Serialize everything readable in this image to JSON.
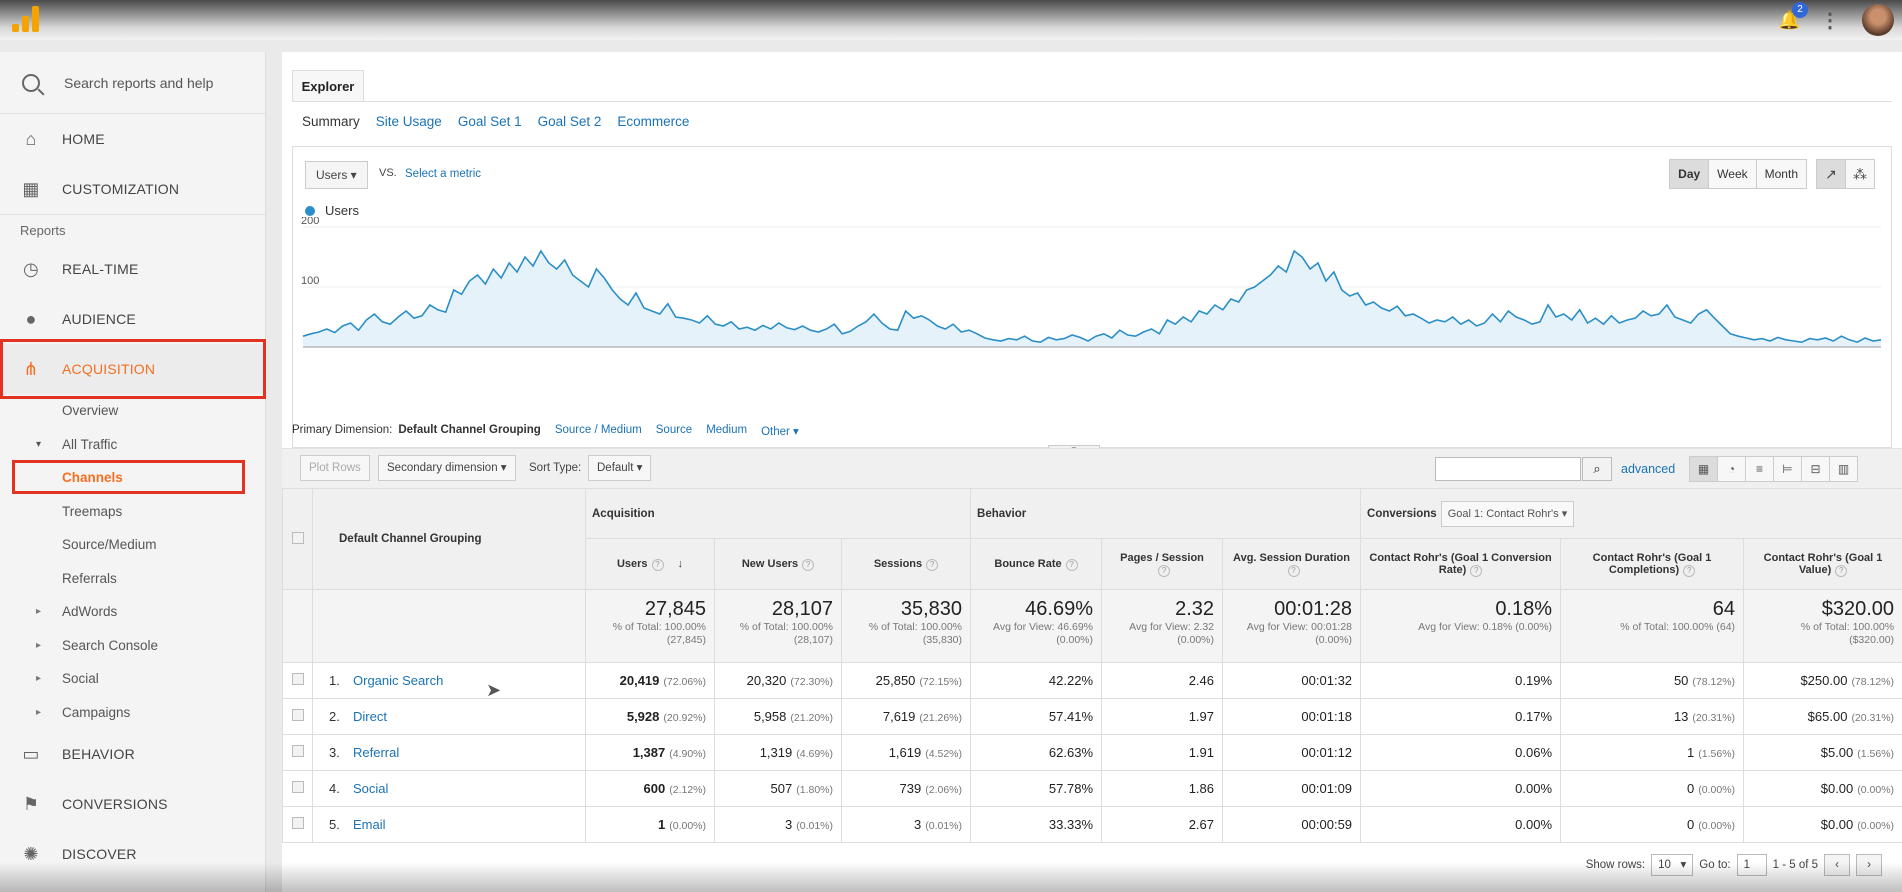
{
  "topbar": {
    "notification_count": "2"
  },
  "sidebar": {
    "search_placeholder": "Search reports and help",
    "home": "HOME",
    "customization": "CUSTOMIZATION",
    "reports_label": "Reports",
    "realtime": "REAL-TIME",
    "audience": "AUDIENCE",
    "acquisition": "ACQUISITION",
    "acquisition_sub": [
      "Overview",
      "All Traffic",
      "Channels",
      "Treemaps",
      "Source/Medium",
      "Referrals",
      "AdWords",
      "Search Console",
      "Social",
      "Campaigns"
    ],
    "behavior": "BEHAVIOR",
    "conversions": "CONVERSIONS",
    "discover": "DISCOVER"
  },
  "explorer": {
    "tab": "Explorer",
    "subtabs": [
      "Summary",
      "Site Usage",
      "Goal Set 1",
      "Goal Set 2",
      "Ecommerce"
    ],
    "metric": "Users",
    "vs": "VS.",
    "select_metric": "Select a metric",
    "periods": [
      "Day",
      "Week",
      "Month"
    ],
    "active_period": "Day",
    "legend": "Users",
    "y_ticks": [
      "200",
      "100"
    ]
  },
  "chart_data": {
    "type": "line",
    "series": [
      {
        "name": "Users",
        "values": [
          18,
          22,
          25,
          30,
          24,
          35,
          40,
          28,
          45,
          55,
          42,
          38,
          50,
          60,
          48,
          52,
          70,
          62,
          58,
          95,
          88,
          110,
          120,
          105,
          130,
          115,
          140,
          125,
          150,
          135,
          160,
          140,
          130,
          145,
          120,
          110,
          100,
          130,
          115,
          95,
          80,
          70,
          90,
          65,
          60,
          55,
          72,
          50,
          48,
          45,
          40,
          52,
          38,
          35,
          42,
          30,
          33,
          28,
          36,
          30,
          40,
          32,
          29,
          35,
          28,
          25,
          30,
          38,
          22,
          26,
          35,
          42,
          55,
          40,
          30,
          28,
          60,
          48,
          52,
          45,
          35,
          30,
          38,
          25,
          28,
          22,
          15,
          12,
          10,
          14,
          12,
          18,
          10,
          8,
          16,
          12,
          14,
          20,
          16,
          10,
          18,
          22,
          15,
          28,
          20,
          18,
          25,
          30,
          22,
          45,
          38,
          50,
          42,
          60,
          55,
          70,
          62,
          80,
          75,
          95,
          100,
          110,
          120,
          135,
          125,
          160,
          150,
          130,
          140,
          110,
          125,
          95,
          85,
          90,
          70,
          75,
          65,
          60,
          68,
          52,
          55,
          48,
          40,
          45,
          42,
          50,
          38,
          45,
          35,
          40,
          55,
          42,
          60,
          50,
          45,
          38,
          42,
          70,
          50,
          55,
          45,
          62,
          40,
          48,
          38,
          52,
          40,
          45,
          48,
          60,
          52,
          55,
          70,
          50,
          45,
          40,
          55,
          62,
          48,
          35,
          22,
          18,
          15,
          12,
          14,
          10,
          16,
          12,
          10,
          8,
          14,
          12,
          15,
          10,
          18,
          12,
          8,
          15,
          10,
          12
        ]
      }
    ],
    "ylim": [
      0,
      200
    ],
    "ylabel": "",
    "xlabel": ""
  },
  "dimension": {
    "label": "Primary Dimension:",
    "current": "Default Channel Grouping",
    "others": [
      "Source / Medium",
      "Source",
      "Medium",
      "Other"
    ]
  },
  "toolbar": {
    "plot_rows": "Plot Rows",
    "secondary": "Secondary dimension",
    "sort_label": "Sort Type:",
    "sort_value": "Default",
    "advanced": "advanced"
  },
  "table": {
    "dim_header": "Default Channel Grouping",
    "groups": {
      "acquisition": "Acquisition",
      "behavior": "Behavior",
      "conversions": "Conversions",
      "goal_select": "Goal 1: Contact Rohr's"
    },
    "columns": [
      "Users",
      "New Users",
      "Sessions",
      "Bounce Rate",
      "Pages / Session",
      "Avg. Session Duration",
      "Contact Rohr's (Goal 1 Conversion Rate)",
      "Contact Rohr's (Goal 1 Completions)",
      "Contact Rohr's (Goal 1 Value)"
    ],
    "totals": [
      {
        "big": "27,845",
        "sub1": "% of Total: 100.00%",
        "sub2": "(27,845)"
      },
      {
        "big": "28,107",
        "sub1": "% of Total: 100.00%",
        "sub2": "(28,107)"
      },
      {
        "big": "35,830",
        "sub1": "% of Total: 100.00%",
        "sub2": "(35,830)"
      },
      {
        "big": "46.69%",
        "sub1": "Avg for View: 46.69%",
        "sub2": "(0.00%)"
      },
      {
        "big": "2.32",
        "sub1": "Avg for View: 2.32",
        "sub2": "(0.00%)"
      },
      {
        "big": "00:01:28",
        "sub1": "Avg for View: 00:01:28",
        "sub2": "(0.00%)"
      },
      {
        "big": "0.18%",
        "sub1": "Avg for View: 0.18% (0.00%)",
        "sub2": ""
      },
      {
        "big": "64",
        "sub1": "% of Total: 100.00% (64)",
        "sub2": ""
      },
      {
        "big": "$320.00",
        "sub1": "% of Total: 100.00%",
        "sub2": "($320.00)"
      }
    ],
    "rows": [
      {
        "n": "1.",
        "name": "Organic Search",
        "users": "20,419",
        "users_pc": "(72.06%)",
        "new": "20,320",
        "new_pc": "(72.30%)",
        "sess": "25,850",
        "sess_pc": "(72.15%)",
        "bounce": "42.22%",
        "pps": "2.46",
        "dur": "00:01:32",
        "cr": "0.19%",
        "comp": "50",
        "comp_pc": "(78.12%)",
        "val": "$250.00",
        "val_pc": "(78.12%)"
      },
      {
        "n": "2.",
        "name": "Direct",
        "users": "5,928",
        "users_pc": "(20.92%)",
        "new": "5,958",
        "new_pc": "(21.20%)",
        "sess": "7,619",
        "sess_pc": "(21.26%)",
        "bounce": "57.41%",
        "pps": "1.97",
        "dur": "00:01:18",
        "cr": "0.17%",
        "comp": "13",
        "comp_pc": "(20.31%)",
        "val": "$65.00",
        "val_pc": "(20.31%)"
      },
      {
        "n": "3.",
        "name": "Referral",
        "users": "1,387",
        "users_pc": "(4.90%)",
        "new": "1,319",
        "new_pc": "(4.69%)",
        "sess": "1,619",
        "sess_pc": "(4.52%)",
        "bounce": "62.63%",
        "pps": "1.91",
        "dur": "00:01:12",
        "cr": "0.06%",
        "comp": "1",
        "comp_pc": "(1.56%)",
        "val": "$5.00",
        "val_pc": "(1.56%)"
      },
      {
        "n": "4.",
        "name": "Social",
        "users": "600",
        "users_pc": "(2.12%)",
        "new": "507",
        "new_pc": "(1.80%)",
        "sess": "739",
        "sess_pc": "(2.06%)",
        "bounce": "57.78%",
        "pps": "1.86",
        "dur": "00:01:09",
        "cr": "0.00%",
        "comp": "0",
        "comp_pc": "(0.00%)",
        "val": "$0.00",
        "val_pc": "(0.00%)"
      },
      {
        "n": "5.",
        "name": "Email",
        "users": "1",
        "users_pc": "(0.00%)",
        "new": "3",
        "new_pc": "(0.01%)",
        "sess": "3",
        "sess_pc": "(0.01%)",
        "bounce": "33.33%",
        "pps": "2.67",
        "dur": "00:00:59",
        "cr": "0.00%",
        "comp": "0",
        "comp_pc": "(0.00%)",
        "val": "$0.00",
        "val_pc": "(0.00%)"
      }
    ]
  },
  "footer": {
    "show_rows_label": "Show rows:",
    "show_rows": "10",
    "goto_label": "Go to:",
    "goto": "1",
    "range": "1 - 5 of 5"
  }
}
